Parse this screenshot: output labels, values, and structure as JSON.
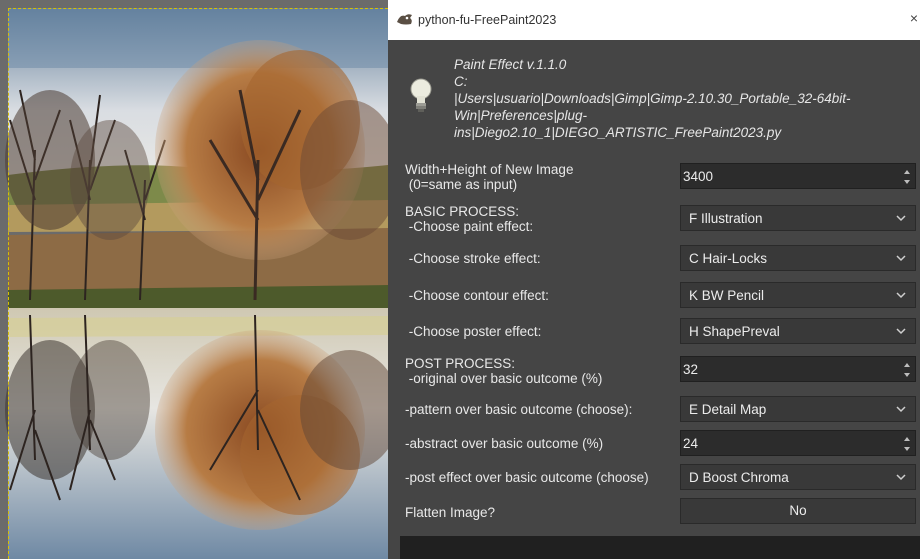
{
  "window": {
    "title": "python-fu-FreePaint2023"
  },
  "info": {
    "lines": [
      "Paint Effect v.1.1.0",
      "C:",
      "|Users|usuario|Downloads|Gimp|Gimp-2.10.30_Portable_32-64bit-",
      "Win|Preferences|plug-",
      "ins|Diego2.10_1|DIEGO_ARTISTIC_FreePaint2023.py"
    ]
  },
  "fields": {
    "width_height": {
      "label1": "Width+Height of New Image",
      "label2": " (0=same as input)",
      "value": "3400"
    },
    "paint_effect": {
      "label1": "BASIC PROCESS:",
      "label2": " -Choose paint effect:",
      "value": "F Illustration"
    },
    "stroke_effect": {
      "label": " -Choose stroke effect:",
      "value": "C Hair-Locks"
    },
    "contour_effect": {
      "label": " -Choose contour effect:",
      "value": "K BW Pencil"
    },
    "poster_effect": {
      "label": " -Choose poster effect:",
      "value": "H ShapePreval"
    },
    "original_over": {
      "label1": "POST PROCESS:",
      "label2": " -original over basic outcome (%)",
      "value": "32"
    },
    "pattern_over": {
      "label": "-pattern over basic outcome (choose):",
      "value": "E Detail Map"
    },
    "abstract_over": {
      "label": "-abstract over basic outcome (%)",
      "value": "24"
    },
    "post_effect": {
      "label": "-post effect over basic outcome (choose)",
      "value": "D Boost Chroma"
    },
    "flatten": {
      "label": "Flatten Image?",
      "value": "No"
    }
  },
  "icons": {
    "app": "gimp-wilber-icon",
    "info": "lightbulb-icon",
    "close": "close-icon"
  },
  "colors": {
    "dialog_bg": "#454545",
    "field_bg": "#2c2c2c",
    "combo_bg": "#393939",
    "text": "#e8e8e8"
  }
}
